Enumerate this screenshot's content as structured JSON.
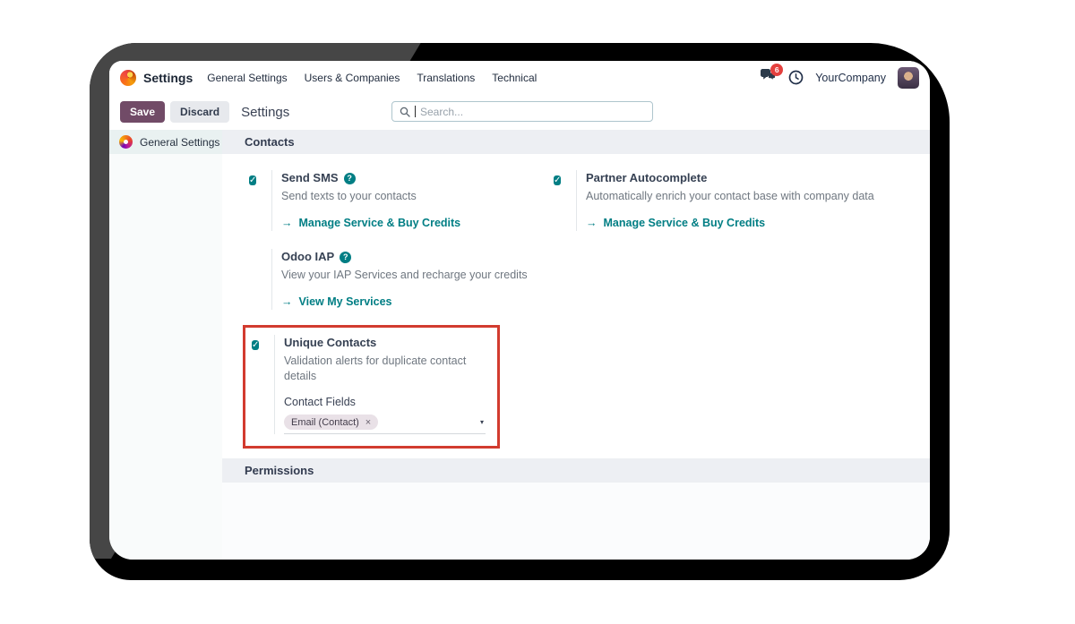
{
  "colors": {
    "accent_teal": "#017e84",
    "save_button_bg": "#714b67",
    "highlight_red": "#d23b2f",
    "badge_red": "#e4403e",
    "section_band_bg": "#edeff3"
  },
  "icons": {
    "check": "✓",
    "arrow": "→",
    "close": "×",
    "caret": "▾",
    "help": "?"
  },
  "navbar": {
    "app_name": "Settings",
    "menus": [
      "General Settings",
      "Users & Companies",
      "Translations",
      "Technical"
    ],
    "message_count": "6",
    "company": "YourCompany"
  },
  "control_bar": {
    "save": "Save",
    "discard": "Discard",
    "breadcrumb": "Settings",
    "search_placeholder": "Search..."
  },
  "sidebar": {
    "items": [
      {
        "label": "General Settings"
      }
    ]
  },
  "sections": {
    "contacts": "Contacts",
    "permissions": "Permissions"
  },
  "settings": [
    {
      "title": "Send SMS",
      "description": "Send texts to your contacts",
      "link": "Manage Service & Buy Credits"
    },
    {
      "title": "Partner Autocomplete",
      "description": "Automatically enrich your contact base with company data",
      "link": "Manage Service & Buy Credits"
    },
    {
      "title": "Odoo IAP",
      "description": "View your IAP Services and recharge your credits",
      "link": "View My Services"
    },
    {
      "title": "Unique Contacts",
      "description": "Validation alerts for duplicate contact details",
      "field_label": "Contact Fields",
      "tag": "Email (Contact)"
    }
  ]
}
